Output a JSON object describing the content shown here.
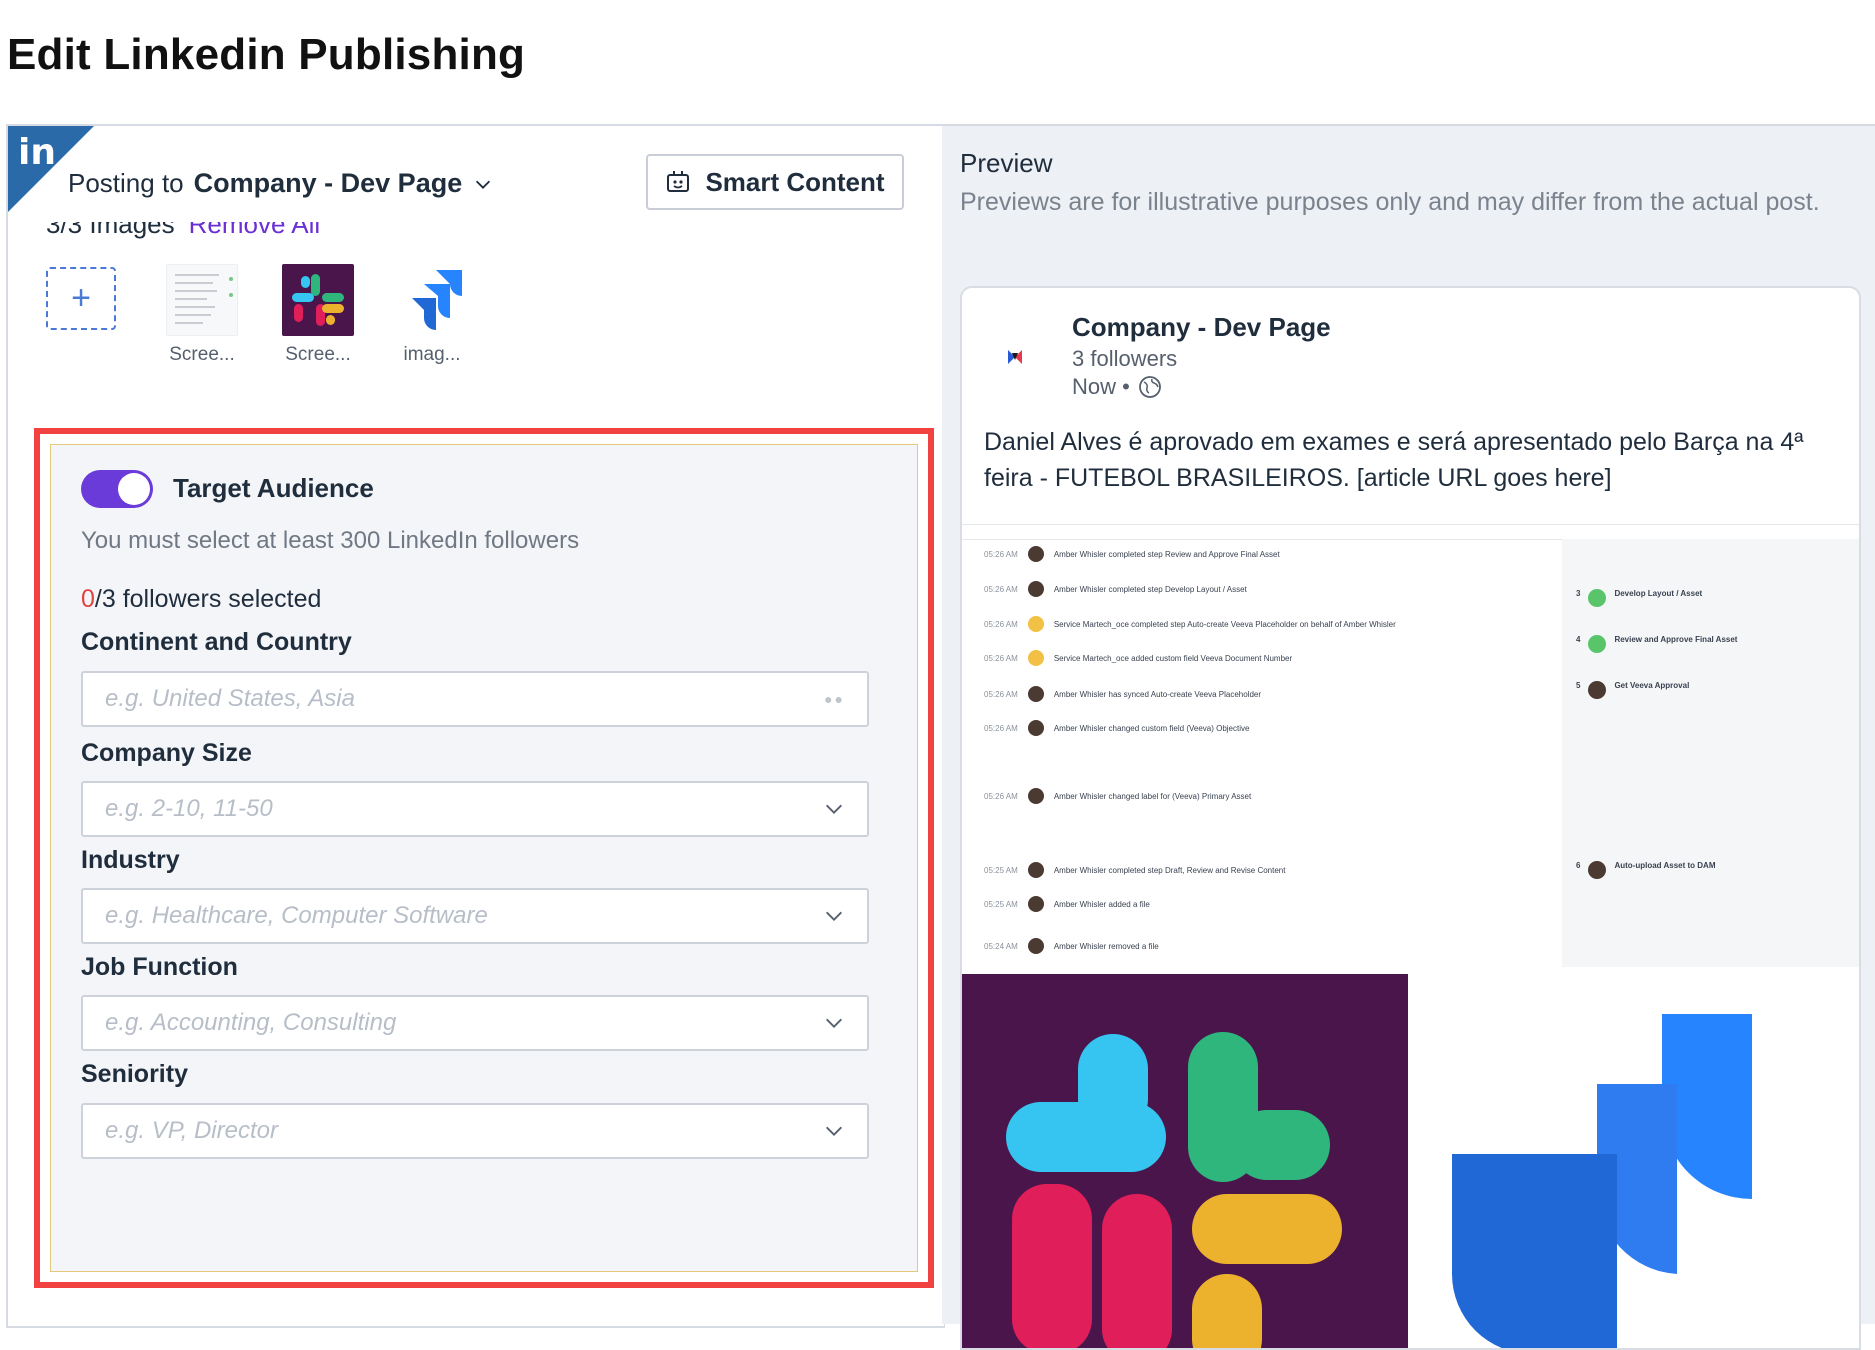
{
  "page": {
    "title": "Edit Linkedin Publishing"
  },
  "editor": {
    "network_badge": "in",
    "posting_prefix": "Posting to",
    "posting_target": "Company - Dev Page",
    "smart_content_label": "Smart Content",
    "images_count_label": "3/3 Images",
    "remove_all_label": "Remove All",
    "thumbnails": [
      {
        "caption": "Scree...",
        "icon": "screenshot-thumbnail"
      },
      {
        "caption": "Scree...",
        "icon": "slack-logo-thumbnail"
      },
      {
        "caption": "imag...",
        "icon": "jira-logo-thumbnail"
      }
    ],
    "audience": {
      "enabled": true,
      "toggle_label": "Target Audience",
      "note": "You must select at least 300 LinkedIn followers",
      "selected_count": "0",
      "selected_suffix": "/3 followers selected",
      "fields": [
        {
          "label": "Continent and Country",
          "placeholder": "e.g. United States, Asia",
          "kind": "tags"
        },
        {
          "label": "Company Size",
          "placeholder": "e.g. 2-10, 11-50",
          "kind": "select"
        },
        {
          "label": "Industry",
          "placeholder": "e.g. Healthcare, Computer Software",
          "kind": "select"
        },
        {
          "label": "Job Function",
          "placeholder": "e.g. Accounting, Consulting",
          "kind": "select"
        },
        {
          "label": "Seniority",
          "placeholder": "e.g. VP, Director",
          "kind": "select"
        }
      ]
    }
  },
  "preview": {
    "title": "Preview",
    "note": "Previews are for illustrative purposes only and may differ from the actual post.",
    "company_name": "Company - Dev Page",
    "followers": "3 followers",
    "time": "Now •",
    "post_text": "Daniel Alves é aprovado em exames e será apresentado pelo Barça na 4ª feira - FUTEBOL BRASILEIROS. [article URL goes here]",
    "activity_rows": [
      {
        "time": "05:26 AM",
        "text": "Amber Whisler completed step Review and Approve Final Asset",
        "avatar": "photo"
      },
      {
        "time": "05:26 AM",
        "text": "Amber Whisler completed step Develop Layout / Asset",
        "avatar": "photo"
      },
      {
        "time": "05:26 AM",
        "text": "Service Martech_oce completed step Auto-create Veeva Placeholder on behalf of Amber Whisler",
        "avatar": "SM"
      },
      {
        "time": "05:26 AM",
        "text": "Service Martech_oce added custom field Veeva Document Number",
        "avatar": "SM"
      },
      {
        "time": "05:26 AM",
        "text": "Amber Whisler has synced Auto-create Veeva Placeholder",
        "avatar": "photo"
      },
      {
        "time": "05:26 AM",
        "text": "Amber Whisler changed custom field (Veeva) Objective",
        "avatar": "photo"
      },
      {
        "time": "05:26 AM",
        "text": "Amber Whisler changed label for (Veeva) Primary Asset",
        "avatar": "photo"
      },
      {
        "time": "05:25 AM",
        "text": "Amber Whisler completed step Draft, Review and Revise Content",
        "avatar": "photo"
      },
      {
        "time": "05:25 AM",
        "text": "Amber Whisler added a file",
        "avatar": "photo"
      },
      {
        "time": "05:24 AM",
        "text": "Amber Whisler removed a file",
        "avatar": "photo"
      }
    ],
    "side_steps": [
      {
        "num": "3",
        "label": "Develop Layout / Asset"
      },
      {
        "num": "4",
        "label": "Review and Approve Final Asset"
      },
      {
        "num": "5",
        "label": "Get Veeva Approval"
      },
      {
        "num": "6",
        "label": "Auto-upload Asset to DAM"
      }
    ]
  },
  "colors": {
    "accent_purple": "#6a3bd8",
    "linkedin_blue": "#2b6aa8",
    "highlight_red": "#f24141",
    "error_red": "#e04343"
  }
}
